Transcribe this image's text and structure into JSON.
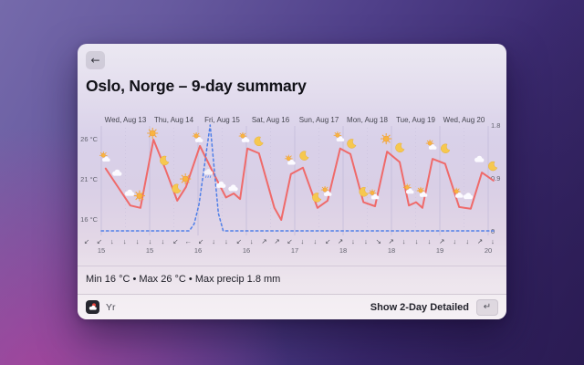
{
  "window": {
    "back_glyph": "←",
    "title": "Oslo, Norge – 9-day summary"
  },
  "summary": {
    "text": "Min 16 °C • Max 26 °C • Max precip 1.8 mm"
  },
  "footer": {
    "source_label": "Yr",
    "action_label": "Show 2-Day Detailed",
    "key_hint": "↵"
  },
  "colors": {
    "temperature_line": "#ef6a6a",
    "precipitation_line": "#4f7fe8",
    "grid": "#c6bedb",
    "axis_text": "#63636f",
    "day_label_text": "#45454f",
    "wind_arrow": "#54545e"
  },
  "chart_data": {
    "type": "line",
    "title": "9-day temperature and precipitation summary",
    "grid": true,
    "days_span": 8.11,
    "day_labels": [
      "Wed, Aug 13",
      "Thu, Aug 14",
      "Fri, Aug 15",
      "Sat, Aug 16",
      "Sun, Aug 17",
      "Mon, Aug 18",
      "Tue, Aug 19",
      "Wed, Aug 20"
    ],
    "y_left": {
      "unit": "°C",
      "labels": [
        "26 °C",
        "21 °C",
        "16 °C"
      ],
      "values": [
        26,
        21,
        16
      ]
    },
    "y_right": {
      "unit": "mm",
      "labels": [
        "1.8",
        "0.9",
        "0"
      ],
      "values": [
        1.8,
        0.9,
        0
      ]
    },
    "x_tick_labels": [
      "15",
      "15",
      "16",
      "16",
      "17",
      "18",
      "18",
      "19",
      "20"
    ],
    "series": [
      {
        "name": "temperature_c",
        "style": "solid",
        "color": "#ef6a6a",
        "points": [
          [
            0.09,
            22.4
          ],
          [
            0.6,
            17.8
          ],
          [
            0.81,
            17.5
          ],
          [
            1.08,
            26.0
          ],
          [
            1.32,
            22.4
          ],
          [
            1.57,
            18.4
          ],
          [
            1.75,
            20.1
          ],
          [
            2.04,
            25.2
          ],
          [
            2.32,
            21.8
          ],
          [
            2.58,
            18.8
          ],
          [
            2.74,
            19.3
          ],
          [
            2.87,
            18.6
          ],
          [
            3.02,
            24.9
          ],
          [
            3.26,
            24.3
          ],
          [
            3.58,
            17.5
          ],
          [
            3.72,
            16.0
          ],
          [
            3.92,
            21.7
          ],
          [
            4.17,
            22.5
          ],
          [
            4.47,
            17.5
          ],
          [
            4.68,
            18.4
          ],
          [
            4.94,
            24.9
          ],
          [
            5.15,
            24.2
          ],
          [
            5.42,
            18.2
          ],
          [
            5.66,
            17.7
          ],
          [
            5.91,
            24.5
          ],
          [
            6.17,
            23.2
          ],
          [
            6.36,
            17.8
          ],
          [
            6.51,
            18.2
          ],
          [
            6.64,
            17.5
          ],
          [
            6.85,
            23.6
          ],
          [
            7.11,
            23.0
          ],
          [
            7.4,
            17.6
          ],
          [
            7.64,
            17.4
          ],
          [
            7.87,
            21.9
          ],
          [
            8.11,
            20.9
          ]
        ]
      },
      {
        "name": "precip_mm",
        "style": "dashed",
        "color": "#4f7fe8",
        "points": [
          [
            0.0,
            0
          ],
          [
            1.82,
            0
          ],
          [
            1.92,
            0.12
          ],
          [
            2.02,
            0.45
          ],
          [
            2.25,
            1.8
          ],
          [
            2.42,
            0.3
          ],
          [
            2.52,
            0
          ],
          [
            8.11,
            0
          ]
        ]
      }
    ],
    "weather_icons": [
      {
        "type": "sun-cloud",
        "day": 0.08,
        "temp": 23.8
      },
      {
        "type": "cloud",
        "day": 0.32,
        "temp": 21.9
      },
      {
        "type": "cloud",
        "day": 0.58,
        "temp": 19.4
      },
      {
        "type": "sun",
        "day": 0.79,
        "temp": 19.0
      },
      {
        "type": "sun",
        "day": 1.06,
        "temp": 26.8
      },
      {
        "type": "moon",
        "day": 1.3,
        "temp": 23.4
      },
      {
        "type": "moon",
        "day": 1.55,
        "temp": 19.9
      },
      {
        "type": "sun",
        "day": 1.74,
        "temp": 21.1
      },
      {
        "type": "sun-cloud",
        "day": 2.0,
        "temp": 26.2
      },
      {
        "type": "cloud-rain",
        "day": 2.21,
        "temp": 21.8
      },
      {
        "type": "cloud",
        "day": 2.47,
        "temp": 20.4
      },
      {
        "type": "cloud",
        "day": 2.72,
        "temp": 20.0
      },
      {
        "type": "sun-cloud",
        "day": 2.96,
        "temp": 26.2
      },
      {
        "type": "moon",
        "day": 3.25,
        "temp": 25.8
      },
      {
        "type": "sun-cloud",
        "day": 3.91,
        "temp": 23.4
      },
      {
        "type": "moon",
        "day": 4.19,
        "temp": 24.0
      },
      {
        "type": "moon",
        "day": 4.45,
        "temp": 18.8
      },
      {
        "type": "sun-cloud",
        "day": 4.66,
        "temp": 19.5
      },
      {
        "type": "sun-cloud",
        "day": 4.92,
        "temp": 26.3
      },
      {
        "type": "moon",
        "day": 5.17,
        "temp": 25.5
      },
      {
        "type": "moon",
        "day": 5.42,
        "temp": 19.5
      },
      {
        "type": "sun-cloud",
        "day": 5.64,
        "temp": 19.1
      },
      {
        "type": "sun",
        "day": 5.89,
        "temp": 26.1
      },
      {
        "type": "moon",
        "day": 6.17,
        "temp": 25.0
      },
      {
        "type": "sun-cloud",
        "day": 6.36,
        "temp": 19.8
      },
      {
        "type": "sun-cloud",
        "day": 6.64,
        "temp": 19.4
      },
      {
        "type": "sun-cloud",
        "day": 6.83,
        "temp": 25.3
      },
      {
        "type": "moon",
        "day": 7.11,
        "temp": 24.9
      },
      {
        "type": "sun-cloud",
        "day": 7.38,
        "temp": 19.3
      },
      {
        "type": "cloud",
        "day": 7.58,
        "temp": 19.0
      },
      {
        "type": "cloud",
        "day": 7.81,
        "temp": 23.6
      },
      {
        "type": "moon",
        "day": 8.09,
        "temp": 22.7
      }
    ],
    "wind_arrows": [
      "↙",
      "↙",
      "↓",
      "↓",
      "↓",
      "↓",
      "↓",
      "↙",
      "←",
      "↙",
      "↓",
      "↓",
      "↙",
      "↓",
      "↗",
      "↗",
      "↙",
      "↓",
      "↓",
      "↙",
      "↗",
      "↓",
      "↓",
      "↘",
      "↗",
      "↓",
      "↓",
      "↓",
      "↗",
      "↓",
      "↓",
      "↗",
      "↓"
    ]
  }
}
